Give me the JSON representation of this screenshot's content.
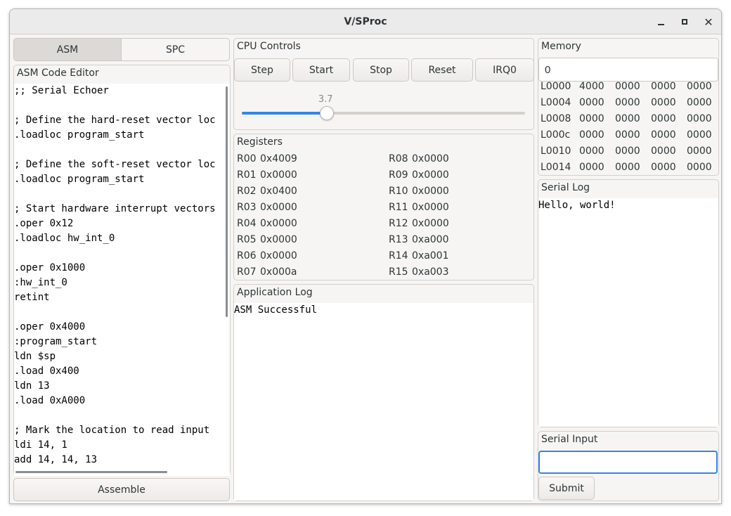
{
  "window": {
    "title": "V/SProc"
  },
  "tabs": [
    {
      "label": "ASM",
      "active": true
    },
    {
      "label": "SPC",
      "active": false
    }
  ],
  "editor": {
    "label": "ASM Code Editor",
    "lines": [
      ";; Serial Echoer",
      "",
      "; Define the hard-reset vector loc",
      ".loadloc program_start",
      "",
      "; Define the soft-reset vector loc",
      ".loadloc program_start",
      "",
      "; Start hardware interrupt vectors",
      ".oper 0x12",
      ".loadloc hw_int_0",
      "",
      ".oper 0x1000",
      ":hw_int_0",
      "retint",
      "",
      ".oper 0x4000",
      ":program_start",
      "ldn $sp",
      ".load 0x400",
      "ldn 13",
      ".load 0xA000",
      "",
      "; Mark the location to read input ",
      "ldi 14, 1",
      "add 14, 14, 13"
    ],
    "assemble_label": "Assemble"
  },
  "cpu_controls": {
    "label": "CPU Controls",
    "buttons": [
      "Step",
      "Start",
      "Stop",
      "Reset",
      "IRQ0"
    ],
    "speed_value": "3.7",
    "speed_fraction": 0.3
  },
  "registers": {
    "label": "Registers",
    "left": [
      {
        "name": "R00",
        "value": "0x4009"
      },
      {
        "name": "R01",
        "value": "0x0000"
      },
      {
        "name": "R02",
        "value": "0x0400"
      },
      {
        "name": "R03",
        "value": "0x0000"
      },
      {
        "name": "R04",
        "value": "0x0000"
      },
      {
        "name": "R05",
        "value": "0x0000"
      },
      {
        "name": "R06",
        "value": "0x0000"
      },
      {
        "name": "R07",
        "value": "0x000a"
      }
    ],
    "right": [
      {
        "name": "R08",
        "value": "0x0000"
      },
      {
        "name": "R09",
        "value": "0x0000"
      },
      {
        "name": "R10",
        "value": "0x0000"
      },
      {
        "name": "R11",
        "value": "0x0000"
      },
      {
        "name": "R12",
        "value": "0x0000"
      },
      {
        "name": "R13",
        "value": "0xa000"
      },
      {
        "name": "R14",
        "value": "0xa001"
      },
      {
        "name": "R15",
        "value": "0xa003"
      }
    ]
  },
  "app_log": {
    "label": "Application Log",
    "text": "ASM Successful"
  },
  "memory": {
    "label": "Memory",
    "address_value": "0",
    "rows": [
      {
        "addr": "L0000",
        "cells": [
          "4000",
          "0000",
          "0000",
          "0000"
        ]
      },
      {
        "addr": "L0004",
        "cells": [
          "0000",
          "0000",
          "0000",
          "0000"
        ]
      },
      {
        "addr": "L0008",
        "cells": [
          "0000",
          "0000",
          "0000",
          "0000"
        ]
      },
      {
        "addr": "L000c",
        "cells": [
          "0000",
          "0000",
          "0000",
          "0000"
        ]
      },
      {
        "addr": "L0010",
        "cells": [
          "0000",
          "0000",
          "0000",
          "0000"
        ]
      },
      {
        "addr": "L0014",
        "cells": [
          "0000",
          "0000",
          "0000",
          "0000"
        ]
      }
    ]
  },
  "serial_log": {
    "label": "Serial Log",
    "text": "Hello, world!"
  },
  "serial_input": {
    "label": "Serial Input",
    "value": "",
    "submit_label": "Submit"
  },
  "colors": {
    "accent": "#3584e4",
    "window_bg": "#f6f5f4"
  }
}
